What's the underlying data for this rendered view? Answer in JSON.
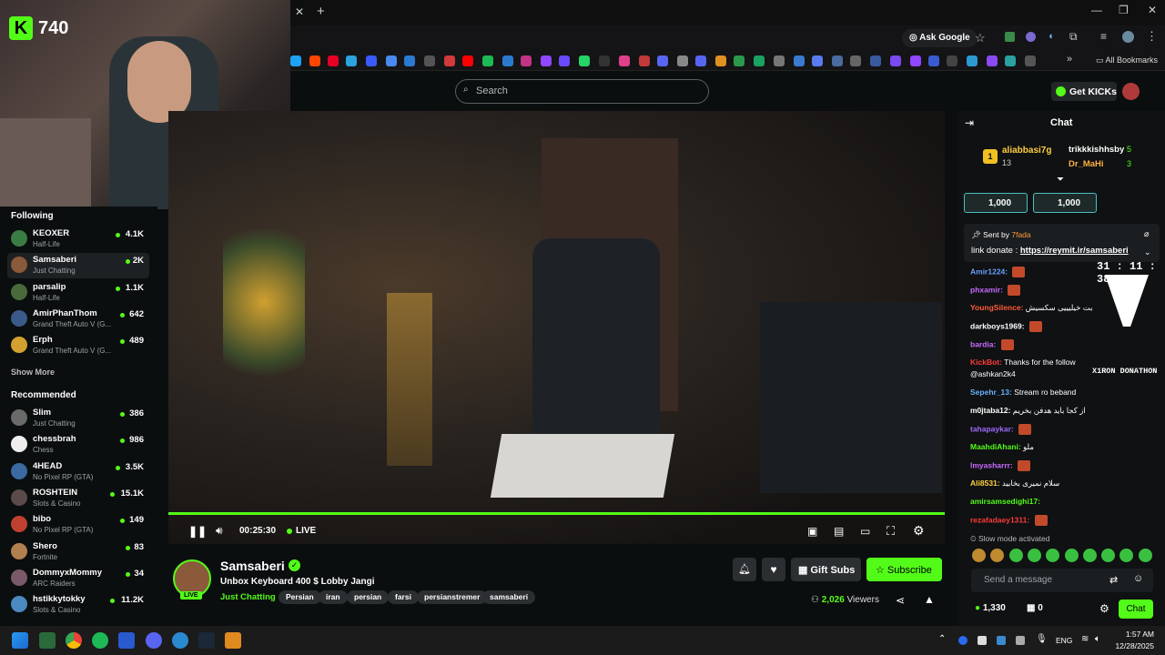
{
  "browser": {
    "ask_google": "Ask Google",
    "all_bookmarks": "All Bookmarks"
  },
  "overlay": {
    "count": "740"
  },
  "header": {
    "search_placeholder": "Search",
    "get_kicks": "Get KICKs"
  },
  "sidebar": {
    "following_title": "Following",
    "show_more": "Show More",
    "recommended_title": "Recommended",
    "following": [
      {
        "name": "KEOXER",
        "category": "Half-Life",
        "viewers": "4.1K",
        "color": "#3a7d44"
      },
      {
        "name": "Samsaberi",
        "category": "Just Chatting",
        "viewers": "2K",
        "color": "#8a5a3a"
      },
      {
        "name": "parsalip",
        "category": "Half-Life",
        "viewers": "1.1K",
        "color": "#4a6a3a"
      },
      {
        "name": "AmirPhanThom",
        "category": "Grand Theft Auto V (G...",
        "viewers": "642",
        "color": "#3a5a8a"
      },
      {
        "name": "Erph",
        "category": "Grand Theft Auto V (G...",
        "viewers": "489",
        "color": "#d4a030"
      }
    ],
    "recommended": [
      {
        "name": "Slim",
        "category": "Just Chatting",
        "viewers": "386",
        "color": "#6a6a6a"
      },
      {
        "name": "chessbrah",
        "category": "Chess",
        "viewers": "986",
        "color": "#eeeeee"
      },
      {
        "name": "4HEAD",
        "category": "No Pixel RP (GTA)",
        "viewers": "3.5K",
        "color": "#3a6aa0"
      },
      {
        "name": "ROSHTEIN",
        "category": "Slots & Casino",
        "viewers": "15.1K",
        "color": "#5a4a4a"
      },
      {
        "name": "bibo",
        "category": "No Pixel RP (GTA)",
        "viewers": "149",
        "color": "#c04030"
      },
      {
        "name": "Shero",
        "category": "Fortnite",
        "viewers": "83",
        "color": "#b08050"
      },
      {
        "name": "DommyxMommy",
        "category": "ARC Raiders",
        "viewers": "34",
        "color": "#7a5a6a"
      },
      {
        "name": "hstikkytokky",
        "category": "Slots & Casino",
        "viewers": "11.2K",
        "color": "#4a8ac0"
      }
    ]
  },
  "player": {
    "time": "00:25:30",
    "live": "LIVE"
  },
  "stream": {
    "name": "Samsaberi",
    "title": "Unbox Keyboard 400 $ Lobby Jangi",
    "category": "Just Chatting",
    "live_badge": "LIVE",
    "tags": [
      "Persian",
      "iran",
      "persian",
      "farsi",
      "persianstremer",
      "samsaberi"
    ],
    "viewers": "2,026",
    "viewers_label": "Viewers",
    "gift_subs": "Gift Subs",
    "subscribe": "Subscribe"
  },
  "chat": {
    "title": "Chat",
    "leader1_name": "aliabbasi7g",
    "leader1_count": "13",
    "leader1_rank": "1",
    "leader2_name": "trikkkishhsby",
    "leader2_count": "5",
    "leader3_name": "Dr_MaHi",
    "leader3_count": "3",
    "gift1": "1,000",
    "gift2": "1,000",
    "pinned_sent_by": "Sent by",
    "pinned_user": "7fada",
    "pinned_text": "link donate :",
    "pinned_link": "https://reymit.ir/samsaberi",
    "timer": "31 : 11 : 38",
    "donathon": "X1RON DONATHON",
    "messages": [
      {
        "user": "Amir1224",
        "text": "",
        "color": "#6aa0ff"
      },
      {
        "user": "phxamir",
        "text": "",
        "color": "#c86aff"
      },
      {
        "user": "YoungSilence",
        "text": "بت خیلیییی سکسیش",
        "color": "#ff5a3a"
      },
      {
        "user": "darkboys1969",
        "text": "",
        "color": "#ffffff"
      },
      {
        "user": "bardia",
        "text": "",
        "color": "#c86aff"
      },
      {
        "user": "KickBot",
        "text": "Thanks for the follow",
        "color": "#ff3a3a"
      },
      {
        "user": "",
        "text": "@ashkan2k4",
        "color": "#ffffff"
      },
      {
        "user": "Sepehr_13",
        "text": "Stream ro beband",
        "color": "#6ab0ff"
      },
      {
        "user": "m0jtaba12",
        "text": "از کجا باید هدفن بخریم",
        "color": "#ffffff"
      },
      {
        "user": "tahapaykar",
        "text": "",
        "color": "#a06aff"
      },
      {
        "user": "MaahdiAhani",
        "text": "ملو",
        "color": "#53fc18"
      },
      {
        "user": "lmyasharrr",
        "text": "",
        "color": "#c86aff"
      },
      {
        "user": "Ali8531",
        "text": "سلام نمیری بخابید",
        "color": "#ffd040"
      },
      {
        "user": "amirsamsedighi17",
        "text": "",
        "color": "#53fc18"
      },
      {
        "user": "rezafadaey1311",
        "text": "",
        "color": "#ff3a3a"
      }
    ],
    "slow_mode": "Slow mode activated",
    "send_placeholder": "Send a message",
    "points": "1,330",
    "gifts": "0",
    "chat_button": "Chat"
  },
  "taskbar": {
    "lang": "ENG",
    "time": "1:57 AM",
    "date": "12/28/2025"
  }
}
